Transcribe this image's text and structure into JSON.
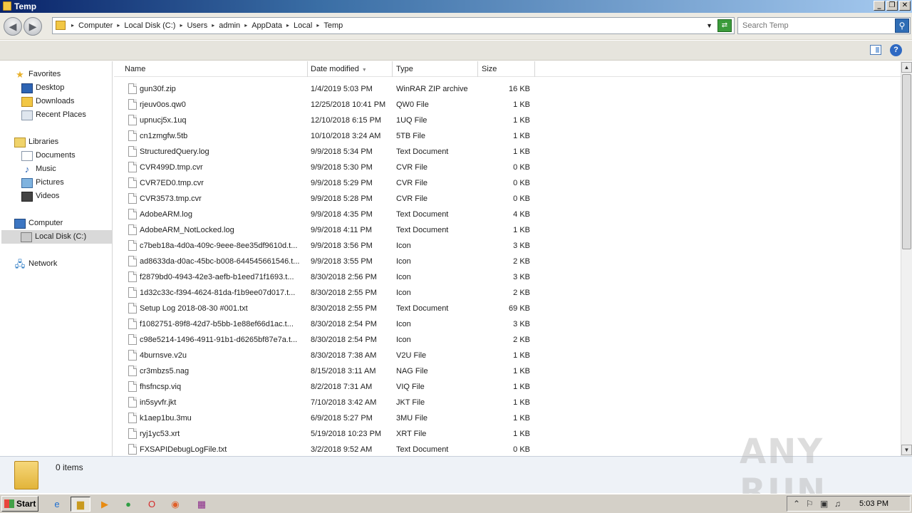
{
  "window": {
    "title": "Temp"
  },
  "address": {
    "crumbs": [
      "Computer",
      "Local Disk (C:)",
      "Users",
      "admin",
      "AppData",
      "Local",
      "Temp"
    ]
  },
  "search": {
    "placeholder": "Search Temp"
  },
  "nav": {
    "favorites": {
      "label": "Favorites",
      "items": [
        "Desktop",
        "Downloads",
        "Recent Places"
      ]
    },
    "libraries": {
      "label": "Libraries",
      "items": [
        "Documents",
        "Music",
        "Pictures",
        "Videos"
      ]
    },
    "computer": {
      "label": "Computer",
      "items": [
        "Local Disk (C:)"
      ]
    },
    "network": {
      "label": "Network"
    }
  },
  "columns": {
    "name": "Name",
    "date": "Date modified",
    "type": "Type",
    "size": "Size"
  },
  "files": [
    {
      "name": "gun30f.zip",
      "date": "1/4/2019 5:03 PM",
      "type": "WinRAR ZIP archive",
      "size": "16 KB"
    },
    {
      "name": "rjeuv0os.qw0",
      "date": "12/25/2018 10:41 PM",
      "type": "QW0 File",
      "size": "1 KB"
    },
    {
      "name": "upnucj5x.1uq",
      "date": "12/10/2018 6:15 PM",
      "type": "1UQ File",
      "size": "1 KB"
    },
    {
      "name": "cn1zmgfw.5tb",
      "date": "10/10/2018 3:24 AM",
      "type": "5TB File",
      "size": "1 KB"
    },
    {
      "name": "StructuredQuery.log",
      "date": "9/9/2018 5:34 PM",
      "type": "Text Document",
      "size": "1 KB"
    },
    {
      "name": "CVR499D.tmp.cvr",
      "date": "9/9/2018 5:30 PM",
      "type": "CVR File",
      "size": "0 KB"
    },
    {
      "name": "CVR7ED0.tmp.cvr",
      "date": "9/9/2018 5:29 PM",
      "type": "CVR File",
      "size": "0 KB"
    },
    {
      "name": "CVR3573.tmp.cvr",
      "date": "9/9/2018 5:28 PM",
      "type": "CVR File",
      "size": "0 KB"
    },
    {
      "name": "AdobeARM.log",
      "date": "9/9/2018 4:35 PM",
      "type": "Text Document",
      "size": "4 KB"
    },
    {
      "name": "AdobeARM_NotLocked.log",
      "date": "9/9/2018 4:11 PM",
      "type": "Text Document",
      "size": "1 KB"
    },
    {
      "name": "c7beb18a-4d0a-409c-9eee-8ee35df9610d.t...",
      "date": "9/9/2018 3:56 PM",
      "type": "Icon",
      "size": "3 KB"
    },
    {
      "name": "ad8633da-d0ac-45bc-b008-644545661546.t...",
      "date": "9/9/2018 3:55 PM",
      "type": "Icon",
      "size": "2 KB"
    },
    {
      "name": "f2879bd0-4943-42e3-aefb-b1eed71f1693.t...",
      "date": "8/30/2018 2:56 PM",
      "type": "Icon",
      "size": "3 KB"
    },
    {
      "name": "1d32c33c-f394-4624-81da-f1b9ee07d017.t...",
      "date": "8/30/2018 2:55 PM",
      "type": "Icon",
      "size": "2 KB"
    },
    {
      "name": "Setup Log 2018-08-30 #001.txt",
      "date": "8/30/2018 2:55 PM",
      "type": "Text Document",
      "size": "69 KB"
    },
    {
      "name": "f1082751-89f8-42d7-b5bb-1e88ef66d1ac.t...",
      "date": "8/30/2018 2:54 PM",
      "type": "Icon",
      "size": "3 KB"
    },
    {
      "name": "c98e5214-1496-4911-91b1-d6265bf87e7a.t...",
      "date": "8/30/2018 2:54 PM",
      "type": "Icon",
      "size": "2 KB"
    },
    {
      "name": "4burnsve.v2u",
      "date": "8/30/2018 7:38 AM",
      "type": "V2U File",
      "size": "1 KB"
    },
    {
      "name": "cr3mbzs5.nag",
      "date": "8/15/2018 3:11 AM",
      "type": "NAG File",
      "size": "1 KB"
    },
    {
      "name": "fhsfncsp.viq",
      "date": "8/2/2018 7:31 AM",
      "type": "VIQ File",
      "size": "1 KB"
    },
    {
      "name": "in5syvfr.jkt",
      "date": "7/10/2018 3:42 AM",
      "type": "JKT File",
      "size": "1 KB"
    },
    {
      "name": "k1aep1bu.3mu",
      "date": "6/9/2018 5:27 PM",
      "type": "3MU File",
      "size": "1 KB"
    },
    {
      "name": "ryj1yc53.xrt",
      "date": "5/19/2018 10:23 PM",
      "type": "XRT File",
      "size": "1 KB"
    },
    {
      "name": "FXSAPIDebugLogFile.txt",
      "date": "3/2/2018 9:52 AM",
      "type": "Text Document",
      "size": "0 KB"
    }
  ],
  "details": {
    "count": "0 items"
  },
  "taskbar": {
    "start": "Start",
    "clock": "5:03 PM"
  },
  "watermark": "ANY RUN"
}
